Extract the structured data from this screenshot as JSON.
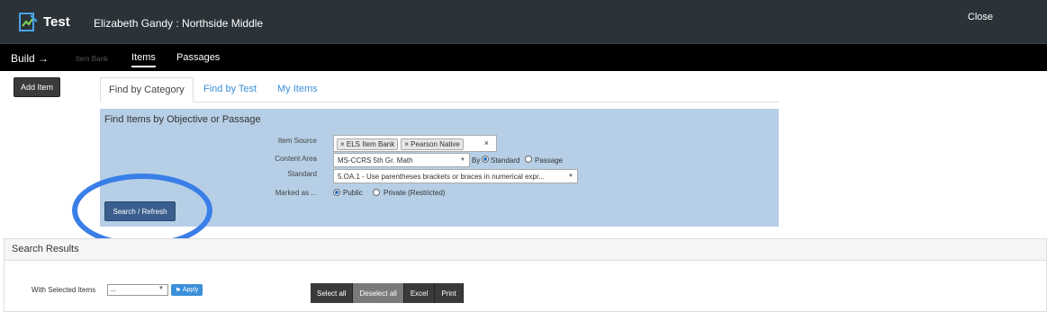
{
  "header": {
    "app_title": "Test",
    "user_school": "Elizabeth Gandy : Northside Middle",
    "close_label": "Close"
  },
  "nav": {
    "build": "Build →",
    "item_bank": "Item Bank",
    "items": "Items",
    "passages": "Passages"
  },
  "add_item_label": "Add Item",
  "tabs": [
    {
      "label": "Find by Category",
      "active": true
    },
    {
      "label": "Find by Test",
      "active": false
    },
    {
      "label": "My Items",
      "active": false
    }
  ],
  "panel": {
    "title": "Find Items by Objective or Passage",
    "item_source_label": "Item Source",
    "item_source_tags": [
      "× ELS Item Bank",
      "× Pearson Native"
    ],
    "clear_symbol": "×",
    "content_area_label": "Content Area",
    "content_area_value": "MS-CCRS 5th Gr. Math",
    "by_label": "By",
    "by_options": [
      "Standard",
      "Passage"
    ],
    "by_selected": "Standard",
    "standard_label": "Standard",
    "standard_value": "5.OA.1 - Use parentheses brackets or braces in numerical expr...",
    "marked_as_label": "Marked as ...",
    "marked_options": [
      "Public",
      "Private (Restricted)"
    ],
    "marked_selected": "Public",
    "search_button": "Search / Refresh"
  },
  "results": {
    "title": "Search Results",
    "with_selected_label": "With Selected Items",
    "with_selected_value": "...",
    "apply_label": "Apply",
    "buttons": [
      "Select all",
      "Deselect all",
      "Excel",
      "Print"
    ]
  },
  "colors": {
    "topbar": "#2b3338",
    "panel": "#b6cfe6",
    "accent": "#3b8fd9",
    "highlight_circle": "#3a7ee8"
  }
}
